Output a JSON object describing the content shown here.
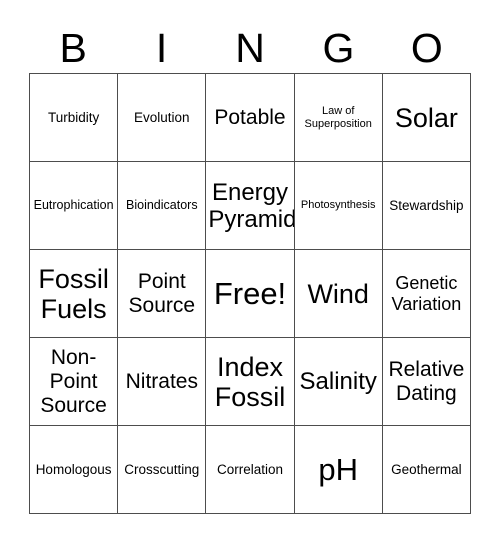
{
  "card": {
    "title": "BINGO",
    "header_letters": [
      "B",
      "I",
      "N",
      "G",
      "O"
    ],
    "border_color": "#4d4d4d",
    "text_color": "#000000",
    "background_color": "#ffffff",
    "rows": [
      [
        {
          "label": "Turbidity",
          "size": "md"
        },
        {
          "label": "Evolution",
          "size": "md"
        },
        {
          "label": "Potable",
          "size": "xl"
        },
        {
          "label": "Law of\nSuperposition",
          "size": "xs"
        },
        {
          "label": "Solar",
          "size": "3xl"
        }
      ],
      [
        {
          "label": "Eutrophication",
          "size": "sm"
        },
        {
          "label": "Bioindicators",
          "size": "sm"
        },
        {
          "label": "Energy\nPyramid",
          "size": "2xl"
        },
        {
          "label": "Photosynthesis",
          "size": "xs"
        },
        {
          "label": "Stewardship",
          "size": "md"
        }
      ],
      [
        {
          "label": "Fossil\nFuels",
          "size": "3xl"
        },
        {
          "label": "Point\nSource",
          "size": "xl"
        },
        {
          "label": "Free!",
          "size": "4xl"
        },
        {
          "label": "Wind",
          "size": "3xl"
        },
        {
          "label": "Genetic\nVariation",
          "size": "lg"
        }
      ],
      [
        {
          "label": "Non-\nPoint\nSource",
          "size": "xl"
        },
        {
          "label": "Nitrates",
          "size": "xl"
        },
        {
          "label": "Index\nFossil",
          "size": "3xl"
        },
        {
          "label": "Salinity",
          "size": "2xl"
        },
        {
          "label": "Relative\nDating",
          "size": "xl"
        }
      ],
      [
        {
          "label": "Homologous",
          "size": "md"
        },
        {
          "label": "Crosscutting",
          "size": "md"
        },
        {
          "label": "Correlation",
          "size": "md"
        },
        {
          "label": "pH",
          "size": "4xl"
        },
        {
          "label": "Geothermal",
          "size": "md"
        }
      ]
    ]
  }
}
